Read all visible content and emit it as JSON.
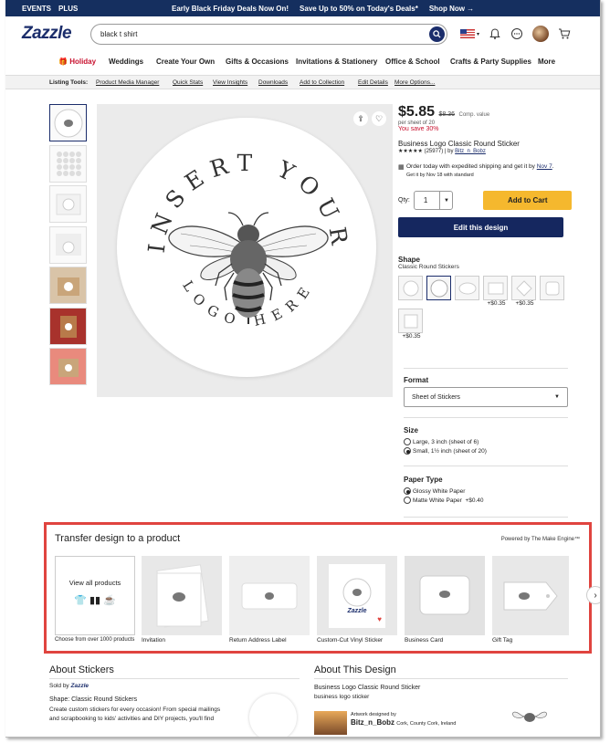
{
  "promo": {
    "events": "EVENTS",
    "plus": "PLUS",
    "deal1": "Early Black Friday Deals Now On!",
    "deal2": "Save Up to 50% on Today's Deals*",
    "shop_now": "Shop Now →"
  },
  "header": {
    "logo": "Zazzle",
    "search_value": "black t shirt"
  },
  "nav": {
    "items": [
      "Holiday",
      "Weddings",
      "Create Your Own",
      "Gifts & Occasions",
      "Invitations & Stationery",
      "Office & School",
      "Crafts & Party Supplies",
      "More"
    ]
  },
  "tools": {
    "label": "Listing Tools:",
    "items": [
      "Product Media Manager",
      "Quick Stats",
      "View Insights",
      "Downloads",
      "Add to Collection",
      "Edit Details",
      "More Options..."
    ]
  },
  "sticker_text": {
    "top": "INSERT YOUR",
    "bottom": "LOGO HERE"
  },
  "product": {
    "price": "$5.85",
    "comp_price": "$8.36",
    "comp_label": "Comp. value",
    "per_sheet": "per sheet of 20",
    "you_save": "You save 30%",
    "name": "Business Logo Classic Round Sticker",
    "stars": "★★★★★",
    "reviews": "(25977) | by",
    "author": "Bitz_n_Bobz",
    "ship_line1": "Order today with expedited shipping and get it by",
    "ship_date": "Nov 7",
    "ship_line2": "Get it by Nov 18 with standard",
    "qty_label": "Qty:",
    "qty_value": "1",
    "add_to_cart": "Add to Cart",
    "edit_design": "Edit this design"
  },
  "shape": {
    "title": "Shape",
    "selected": "Classic Round Stickers",
    "prices": [
      "",
      "",
      "",
      "+$0.35",
      "+$0.35",
      "",
      "+$0.35"
    ]
  },
  "format": {
    "title": "Format",
    "selected": "Sheet of Stickers"
  },
  "size": {
    "title": "Size",
    "options": [
      {
        "label": "Large, 3 inch (sheet of 6)",
        "selected": false
      },
      {
        "label": "Small, 1½ inch (sheet of 20)",
        "selected": true
      }
    ]
  },
  "paper": {
    "title": "Paper Type",
    "options": [
      {
        "label": "Glossy White Paper",
        "price": "",
        "selected": true
      },
      {
        "label": "Matte White Paper",
        "price": "+$0.40",
        "selected": false
      }
    ]
  },
  "transfer": {
    "title": "Transfer design to a product",
    "powered": "Powered by The Make Engine™",
    "view_all": "View all products",
    "choose": "Choose from over 1000 products",
    "items": [
      "Invitation",
      "Return Address Label",
      "Custom-Cut Vinyl Sticker",
      "Business Card",
      "Gift Tag"
    ],
    "zazzle": "Zazzle"
  },
  "about_stickers": {
    "title": "About Stickers",
    "sold_by": "Sold by",
    "sold_brand": "Zazzle",
    "shape_line": "Shape: Classic Round Stickers",
    "desc1": "Create custom stickers for every occasion! From special mailings",
    "desc2": "and scrapbooking to kids' activities and DIY projects, you'll find"
  },
  "about_design": {
    "title": "About This Design",
    "name": "Business Logo Classic Round Sticker",
    "sub": "business logo sticker",
    "designed_by": "Artwork designed by",
    "designer": "Bitz_n_Bobz",
    "location": "Cork, County Cork, Ireland"
  }
}
